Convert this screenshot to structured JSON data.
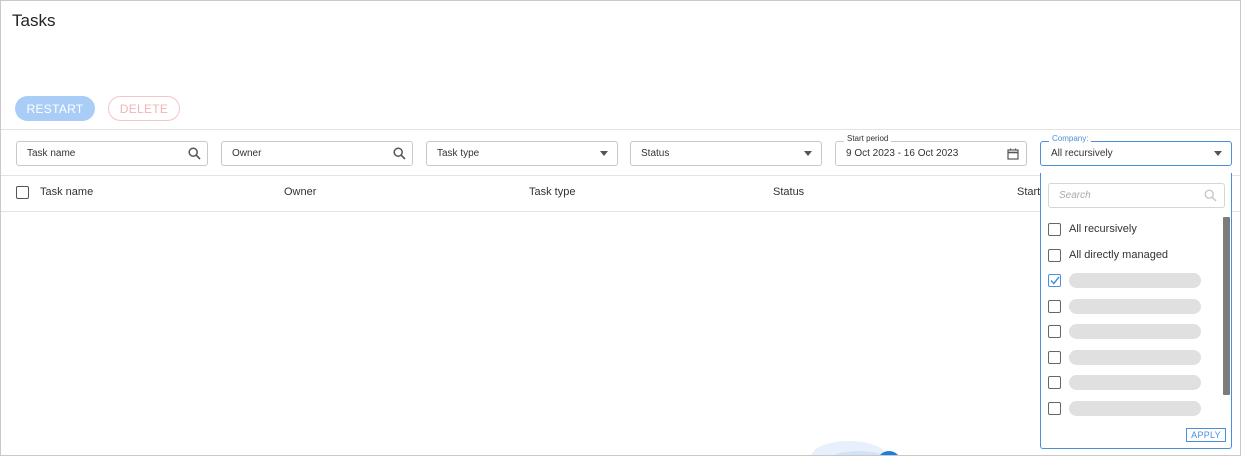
{
  "page": {
    "title": "Tasks"
  },
  "actions": {
    "restart_label": "RESTART",
    "delete_label": "DELETE"
  },
  "filters": {
    "task_name": {
      "placeholder": "Task name",
      "icon": "search-icon"
    },
    "owner": {
      "placeholder": "Owner",
      "icon": "search-icon"
    },
    "task_type": {
      "placeholder": "Task type",
      "icon": "chevron-down-icon"
    },
    "status": {
      "placeholder": "Status",
      "icon": "chevron-down-icon"
    },
    "start_period": {
      "label": "Start period",
      "value": "9 Oct 2023 - 16 Oct 2023",
      "icon": "calendar-icon"
    },
    "company": {
      "label": "Company:",
      "value": "All recursively",
      "icon": "chevron-down-icon"
    }
  },
  "table": {
    "columns": [
      "Task name",
      "Owner",
      "Task type",
      "Status",
      "Start"
    ]
  },
  "company_dropdown": {
    "search_placeholder": "Search",
    "options": [
      {
        "label": "All recursively",
        "checked": false
      },
      {
        "label": "All directly managed",
        "checked": false
      },
      {
        "label": "",
        "checked": true
      },
      {
        "label": "",
        "checked": false
      },
      {
        "label": "",
        "checked": false
      },
      {
        "label": "",
        "checked": false
      },
      {
        "label": "",
        "checked": false
      },
      {
        "label": "",
        "checked": false
      }
    ],
    "apply_label": "APPLY"
  },
  "colors": {
    "accent": "#4a90d9",
    "restart_bg": "#a9cdf7",
    "delete_border": "#f2c6c6"
  }
}
